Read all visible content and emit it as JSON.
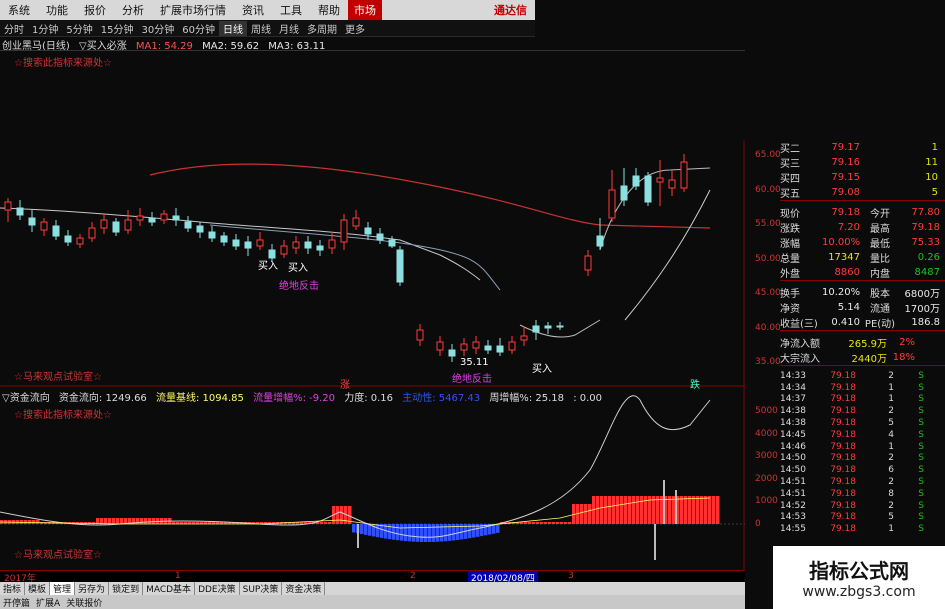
{
  "menu": {
    "items": [
      "系统",
      "功能",
      "报价",
      "分析",
      "扩展市场行情",
      "资讯",
      "工具",
      "帮助"
    ],
    "highlight": "市场",
    "right": "通达信"
  },
  "periods": {
    "items": [
      "分时",
      "1分钟",
      "5分钟",
      "15分钟",
      "30分钟",
      "60分钟",
      "日线",
      "周线",
      "月线",
      "多周期",
      "更多"
    ],
    "active_index": 6
  },
  "ma_line": {
    "name": "创业黑马(日线)",
    "indicator": "▽买入必涨",
    "ma1": "MA1: 54.29",
    "ma2": "MA2: 59.62",
    "ma3": "MA3: 63.11"
  },
  "watermarks": {
    "top": "☆搜索此指标来源处☆",
    "mid": "☆马来观点试验室☆",
    "ind_top": "☆搜索此指标来源处☆",
    "ind_bottom": "☆马来观点试验室☆"
  },
  "annotations": {
    "buy1": "买入",
    "buy2": "买入",
    "buy3": "买入",
    "reb1": "绝地反击",
    "reb2": "绝地反击",
    "reb3": "35.11",
    "hi": "65.96",
    "zhang": "涨",
    "die": "跌"
  },
  "indicator_bar": {
    "name": "▽资金流向",
    "v1": "资金流向: 1249.66",
    "v2": "流量基线: 1094.85",
    "v3": "流量增幅%: -9.20",
    "v4": "力度: 0.16",
    "v5": "主动性: 5467.43",
    "v6": "周增幅%: 25.18",
    "v7": ": 0.00"
  },
  "price_axis": [
    "65.00",
    "60.00",
    "55.00",
    "50.00",
    "45.00",
    "40.00",
    "35.00"
  ],
  "ind_axis": [
    "5000",
    "4000",
    "3000",
    "2000",
    "1000",
    "0"
  ],
  "quote": {
    "asks": [
      {
        "label": "买二",
        "price": "79.17",
        "vol": "1"
      },
      {
        "label": "买三",
        "price": "79.16",
        "vol": "11"
      },
      {
        "label": "买四",
        "price": "79.15",
        "vol": "10"
      },
      {
        "label": "买五",
        "price": "79.08",
        "vol": "5"
      }
    ],
    "stats": [
      {
        "l1": "现价",
        "v1": "79.18",
        "l2": "今开",
        "v2": "77.80",
        "c1": "red",
        "c2": "red"
      },
      {
        "l1": "涨跌",
        "v1": "7.20",
        "l2": "最高",
        "v2": "79.18",
        "c1": "red",
        "c2": "red"
      },
      {
        "l1": "涨幅",
        "v1": "10.00%",
        "l2": "最低",
        "v2": "75.33",
        "c1": "red",
        "c2": "red"
      },
      {
        "l1": "总量",
        "v1": "17347",
        "l2": "量比",
        "v2": "0.26",
        "c1": "yel",
        "c2": "grn"
      },
      {
        "l1": "外盘",
        "v1": "8860",
        "l2": "内盘",
        "v2": "8487",
        "c1": "red",
        "c2": "grn"
      }
    ],
    "stats2": [
      {
        "l1": "换手",
        "v1": "10.20%",
        "l2": "股本",
        "v2": "6800万",
        "c1": "wht",
        "c2": "wht"
      },
      {
        "l1": "净资",
        "v1": "5.14",
        "l2": "流通",
        "v2": "1700万",
        "c1": "wht",
        "c2": "wht"
      },
      {
        "l1": "收益(三)",
        "v1": "0.410",
        "l2": "PE(动)",
        "v2": "186.8",
        "c1": "wht",
        "c2": "wht"
      }
    ],
    "flow": [
      {
        "label": "净流入额",
        "v": "265.9万",
        "p": "2%"
      },
      {
        "label": "大宗流入",
        "v": "2440万",
        "p": "18%"
      }
    ],
    "ticks": [
      {
        "t": "14:33",
        "p": "79.18",
        "v": "2",
        "s": "S"
      },
      {
        "t": "14:34",
        "p": "79.18",
        "v": "1",
        "s": "S"
      },
      {
        "t": "14:37",
        "p": "79.18",
        "v": "1",
        "s": "S"
      },
      {
        "t": "14:38",
        "p": "79.18",
        "v": "2",
        "s": "S"
      },
      {
        "t": "14:38",
        "p": "79.18",
        "v": "5",
        "s": "S"
      },
      {
        "t": "14:45",
        "p": "79.18",
        "v": "4",
        "s": "S"
      },
      {
        "t": "14:46",
        "p": "79.18",
        "v": "1",
        "s": "S"
      },
      {
        "t": "14:50",
        "p": "79.18",
        "v": "2",
        "s": "S"
      },
      {
        "t": "14:50",
        "p": "79.18",
        "v": "6",
        "s": "S"
      },
      {
        "t": "14:51",
        "p": "79.18",
        "v": "2",
        "s": "S"
      },
      {
        "t": "14:51",
        "p": "79.18",
        "v": "8",
        "s": "S"
      },
      {
        "t": "14:52",
        "p": "79.18",
        "v": "2",
        "s": "S"
      },
      {
        "t": "14:53",
        "p": "79.18",
        "v": "5",
        "s": "S"
      },
      {
        "t": "14:55",
        "p": "79.18",
        "v": "1",
        "s": "S"
      }
    ]
  },
  "time_axis": {
    "year": "2017年",
    "m1": "1",
    "m2": "2",
    "sel": "2018/02/08/四",
    "m3": "3"
  },
  "tabs": [
    "指标",
    "模板",
    "管理",
    "另存为",
    "锁定到",
    "MACD基本",
    "DDE决策",
    "SUP决策",
    "资金决策"
  ],
  "tab_active": 2,
  "bottom": [
    "开停篇",
    "扩展A",
    "关联报价"
  ],
  "logo": {
    "big": "指标公式网",
    "small": "www.zbgs3.com"
  },
  "colors": {
    "up": "#ff3b3b",
    "down": "#19c219",
    "bg": "#0b0b0b",
    "accent": "#c00000"
  }
}
